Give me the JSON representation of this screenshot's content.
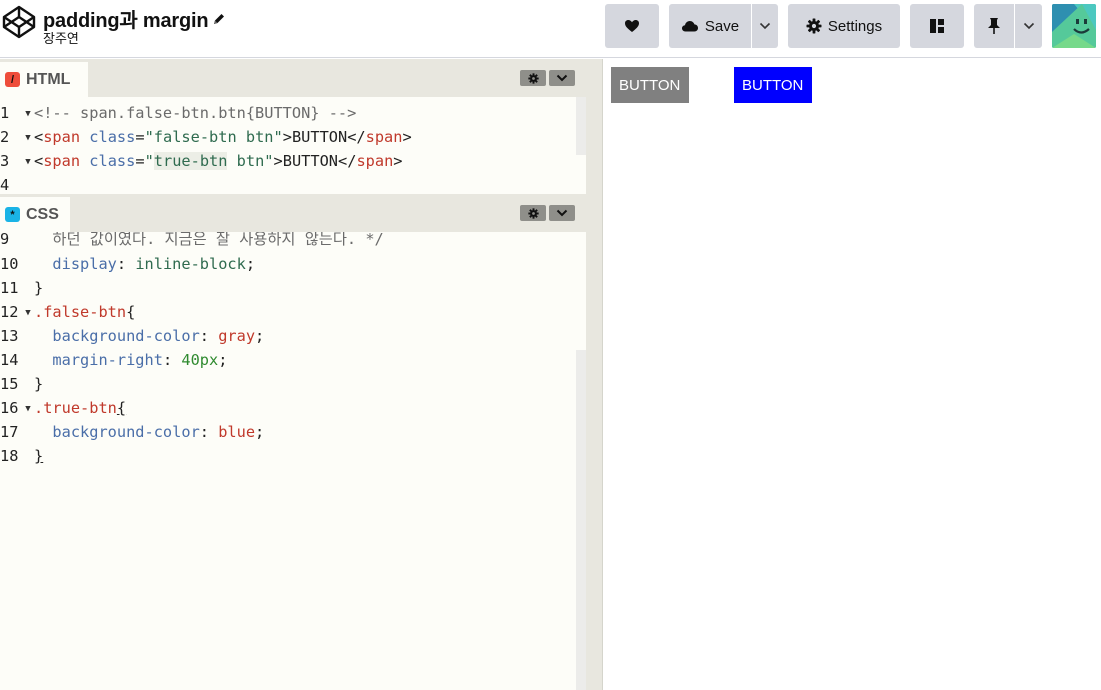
{
  "header": {
    "title": "padding과 margin",
    "author": "장주연",
    "save_label": "Save",
    "settings_label": "Settings"
  },
  "html_editor": {
    "label": "HTML",
    "lines": [
      {
        "n": "1",
        "fold": true
      },
      {
        "n": "2",
        "fold": true
      },
      {
        "n": "3",
        "fold": true
      },
      {
        "n": "4",
        "fold": false
      }
    ],
    "t": {
      "l1": "<!-- span.false-btn.btn{BUTTON} -->",
      "lt": "<",
      "gt": ">",
      "span": "span",
      "class": "class",
      "eq": "=",
      "false_cls": "\"false-btn btn\"",
      "true_cls_a": "\"",
      "true_cls_b": "true-btn",
      "true_cls_c": " btn\"",
      "button": "BUTTON",
      "close": "</"
    }
  },
  "css_editor": {
    "label": "CSS",
    "line_numbers": [
      "9",
      "10",
      "11",
      "12",
      "13",
      "14",
      "15",
      "16",
      "17",
      "18"
    ],
    "l9": "  하던 값이였다. 지금은 잘 사용하지 않는다. */",
    "l10_prop": "display",
    "l10_val": "inline-block",
    "l12_sel": ".false-btn",
    "l13_prop": "background-color",
    "l13_val": "gray",
    "l14_prop": "margin-right",
    "l14_val": "40px",
    "l16_sel": ".true-btn",
    "l17_prop": "background-color",
    "l17_val": "blue",
    "brace_open": "{",
    "brace_close": "}",
    "colon": ": ",
    "semi": ";"
  },
  "preview": {
    "false_btn": "BUTTON",
    "true_btn": "BUTTON"
  },
  "colors": {
    "false_btn_bg": "#808080",
    "true_btn_bg": "#0000ff"
  }
}
